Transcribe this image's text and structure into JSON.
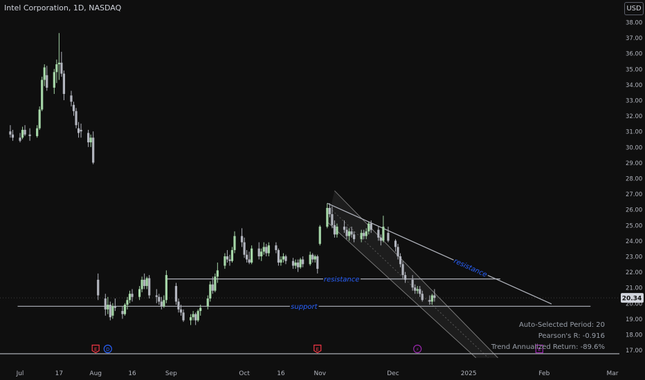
{
  "header": {
    "title": "Intel Corporation, 1D, NASDAQ",
    "currency": "USD"
  },
  "price_label": "20.34",
  "stats": {
    "period": "Auto-Selected Period: 20",
    "pearson": "Pearson's R: -0.916",
    "trend": "Trend Annualized Return: -89.6%"
  },
  "colors": {
    "up": "#a5d6a7",
    "down": "#b2b5be",
    "background": "#0f0f0f",
    "annotation": "#2962ff",
    "event": "#f23645",
    "dividend": "#2962ff",
    "split": "#9c27b0"
  },
  "chart_data": {
    "type": "candlestick",
    "title": "Intel Corporation, 1D, NASDAQ",
    "ylim": [
      16.5,
      39.0
    ],
    "y_ticks": [
      "17.00",
      "18.00",
      "19.00",
      "20.00",
      "21.00",
      "22.00",
      "23.00",
      "24.00",
      "25.00",
      "26.00",
      "27.00",
      "28.00",
      "29.00",
      "30.00",
      "31.00",
      "32.00",
      "33.00",
      "34.00",
      "35.00",
      "36.00",
      "37.00",
      "38.00"
    ],
    "x_ticks": [
      {
        "label": "Jul",
        "date": "2024-07-01"
      },
      {
        "label": "17",
        "date": "2024-07-17"
      },
      {
        "label": "Aug",
        "date": "2024-08-01"
      },
      {
        "label": "16",
        "date": "2024-08-16"
      },
      {
        "label": "Sep",
        "date": "2024-09-01"
      },
      {
        "label": "Oct",
        "date": "2024-10-01"
      },
      {
        "label": "16",
        "date": "2024-10-16"
      },
      {
        "label": "Nov",
        "date": "2024-11-01"
      },
      {
        "label": "Dec",
        "date": "2024-12-01"
      },
      {
        "label": "2025",
        "date": "2025-01-01"
      },
      {
        "label": "Feb",
        "date": "2025-02-01"
      },
      {
        "label": "Mar",
        "date": "2025-03-01"
      }
    ],
    "candles": [
      {
        "d": "2024-06-27",
        "o": 31.0,
        "h": 31.4,
        "l": 30.6,
        "c": 30.8
      },
      {
        "d": "2024-06-28",
        "o": 30.8,
        "h": 31.1,
        "l": 30.4,
        "c": 30.6
      },
      {
        "d": "2024-07-01",
        "o": 30.6,
        "h": 30.9,
        "l": 30.3,
        "c": 30.4
      },
      {
        "d": "2024-07-02",
        "o": 30.6,
        "h": 31.3,
        "l": 30.5,
        "c": 31.1
      },
      {
        "d": "2024-07-03",
        "o": 31.1,
        "h": 31.4,
        "l": 30.7,
        "c": 30.8
      },
      {
        "d": "2024-07-05",
        "o": 30.8,
        "h": 31.2,
        "l": 30.4,
        "c": 30.7
      },
      {
        "d": "2024-07-08",
        "o": 30.7,
        "h": 31.4,
        "l": 30.6,
        "c": 31.2
      },
      {
        "d": "2024-07-09",
        "o": 31.2,
        "h": 32.6,
        "l": 31.1,
        "c": 32.4
      },
      {
        "d": "2024-07-10",
        "o": 32.4,
        "h": 34.5,
        "l": 32.3,
        "c": 34.3
      },
      {
        "d": "2024-07-11",
        "o": 34.3,
        "h": 35.3,
        "l": 33.9,
        "c": 35.1
      },
      {
        "d": "2024-07-12",
        "o": 34.6,
        "h": 35.2,
        "l": 33.6,
        "c": 33.8
      },
      {
        "d": "2024-07-15",
        "o": 33.8,
        "h": 35.0,
        "l": 33.4,
        "c": 34.8
      },
      {
        "d": "2024-07-16",
        "o": 34.8,
        "h": 35.6,
        "l": 34.1,
        "c": 35.3
      },
      {
        "d": "2024-07-17",
        "o": 35.3,
        "h": 37.3,
        "l": 34.3,
        "c": 35.4
      },
      {
        "d": "2024-07-18",
        "o": 35.4,
        "h": 36.1,
        "l": 34.5,
        "c": 34.7
      },
      {
        "d": "2024-07-19",
        "o": 34.7,
        "h": 34.9,
        "l": 33.0,
        "c": 33.4
      },
      {
        "d": "2024-07-22",
        "o": 33.3,
        "h": 33.6,
        "l": 32.6,
        "c": 32.9
      },
      {
        "d": "2024-07-23",
        "o": 32.7,
        "h": 32.9,
        "l": 32.0,
        "c": 32.3
      },
      {
        "d": "2024-07-24",
        "o": 32.3,
        "h": 32.5,
        "l": 31.2,
        "c": 31.4
      },
      {
        "d": "2024-07-25",
        "o": 31.2,
        "h": 31.6,
        "l": 30.6,
        "c": 30.9
      },
      {
        "d": "2024-07-26",
        "o": 31.1,
        "h": 31.5,
        "l": 30.6,
        "c": 31.0
      },
      {
        "d": "2024-07-29",
        "o": 30.9,
        "h": 31.1,
        "l": 30.0,
        "c": 30.3
      },
      {
        "d": "2024-07-30",
        "o": 30.3,
        "h": 30.8,
        "l": 30.0,
        "c": 30.6
      },
      {
        "d": "2024-07-31",
        "o": 30.6,
        "h": 31.0,
        "l": 28.9,
        "c": 29.0
      },
      {
        "d": "2024-08-02",
        "o": 21.5,
        "h": 21.9,
        "l": 20.2,
        "c": 20.5
      },
      {
        "d": "2024-08-05",
        "o": 20.3,
        "h": 20.6,
        "l": 19.2,
        "c": 19.6
      },
      {
        "d": "2024-08-06",
        "o": 19.6,
        "h": 20.4,
        "l": 19.3,
        "c": 19.9
      },
      {
        "d": "2024-08-07",
        "o": 19.9,
        "h": 20.1,
        "l": 18.9,
        "c": 19.1
      },
      {
        "d": "2024-08-08",
        "o": 19.2,
        "h": 20.0,
        "l": 19.0,
        "c": 19.8
      },
      {
        "d": "2024-08-09",
        "o": 19.8,
        "h": 20.3,
        "l": 19.5,
        "c": 19.7
      },
      {
        "d": "2024-08-12",
        "o": 19.5,
        "h": 19.8,
        "l": 19.0,
        "c": 19.3
      },
      {
        "d": "2024-08-13",
        "o": 19.3,
        "h": 20.0,
        "l": 19.2,
        "c": 19.9
      },
      {
        "d": "2024-08-14",
        "o": 19.9,
        "h": 20.4,
        "l": 19.6,
        "c": 20.2
      },
      {
        "d": "2024-08-15",
        "o": 20.2,
        "h": 20.8,
        "l": 20.0,
        "c": 20.6
      },
      {
        "d": "2024-08-16",
        "o": 20.6,
        "h": 20.9,
        "l": 20.1,
        "c": 20.4
      },
      {
        "d": "2024-08-19",
        "o": 20.4,
        "h": 21.1,
        "l": 20.2,
        "c": 20.9
      },
      {
        "d": "2024-08-20",
        "o": 20.9,
        "h": 21.7,
        "l": 20.7,
        "c": 21.5
      },
      {
        "d": "2024-08-21",
        "o": 21.5,
        "h": 21.9,
        "l": 20.9,
        "c": 21.1
      },
      {
        "d": "2024-08-22",
        "o": 21.1,
        "h": 21.7,
        "l": 20.9,
        "c": 21.6
      },
      {
        "d": "2024-08-23",
        "o": 21.6,
        "h": 21.8,
        "l": 20.3,
        "c": 20.5
      },
      {
        "d": "2024-08-26",
        "o": 20.5,
        "h": 20.9,
        "l": 20.0,
        "c": 20.4
      },
      {
        "d": "2024-08-27",
        "o": 20.4,
        "h": 20.6,
        "l": 19.9,
        "c": 20.1
      },
      {
        "d": "2024-08-28",
        "o": 20.1,
        "h": 20.4,
        "l": 19.6,
        "c": 19.8
      },
      {
        "d": "2024-08-29",
        "o": 19.8,
        "h": 20.5,
        "l": 19.7,
        "c": 20.2
      },
      {
        "d": "2024-08-30",
        "o": 20.2,
        "h": 22.1,
        "l": 20.0,
        "c": 21.8
      },
      {
        "d": "2024-09-03",
        "o": 21.1,
        "h": 21.3,
        "l": 19.9,
        "c": 20.1
      },
      {
        "d": "2024-09-04",
        "o": 20.1,
        "h": 20.3,
        "l": 19.4,
        "c": 19.6
      },
      {
        "d": "2024-09-05",
        "o": 19.6,
        "h": 19.9,
        "l": 19.2,
        "c": 19.4
      },
      {
        "d": "2024-09-06",
        "o": 19.4,
        "h": 19.6,
        "l": 18.8,
        "c": 18.9
      },
      {
        "d": "2024-09-09",
        "o": 18.9,
        "h": 19.3,
        "l": 18.6,
        "c": 19.1
      },
      {
        "d": "2024-09-10",
        "o": 19.1,
        "h": 19.5,
        "l": 18.9,
        "c": 19.3
      },
      {
        "d": "2024-09-11",
        "o": 19.3,
        "h": 19.4,
        "l": 18.6,
        "c": 18.9
      },
      {
        "d": "2024-09-12",
        "o": 18.9,
        "h": 19.6,
        "l": 18.8,
        "c": 19.5
      },
      {
        "d": "2024-09-13",
        "o": 19.5,
        "h": 19.9,
        "l": 19.2,
        "c": 19.7
      },
      {
        "d": "2024-09-16",
        "o": 19.8,
        "h": 20.5,
        "l": 19.6,
        "c": 20.3
      },
      {
        "d": "2024-09-17",
        "o": 20.3,
        "h": 21.4,
        "l": 20.1,
        "c": 21.2
      },
      {
        "d": "2024-09-18",
        "o": 21.2,
        "h": 21.7,
        "l": 20.6,
        "c": 20.8
      },
      {
        "d": "2024-09-19",
        "o": 20.8,
        "h": 21.9,
        "l": 20.7,
        "c": 21.7
      },
      {
        "d": "2024-09-20",
        "o": 21.7,
        "h": 22.6,
        "l": 21.3,
        "c": 22.1
      },
      {
        "d": "2024-09-23",
        "o": 22.4,
        "h": 23.2,
        "l": 22.2,
        "c": 23.0
      },
      {
        "d": "2024-09-24",
        "o": 23.0,
        "h": 23.4,
        "l": 22.6,
        "c": 22.8
      },
      {
        "d": "2024-09-25",
        "o": 22.8,
        "h": 23.1,
        "l": 22.4,
        "c": 22.7
      },
      {
        "d": "2024-09-26",
        "o": 22.7,
        "h": 23.6,
        "l": 22.6,
        "c": 23.4
      },
      {
        "d": "2024-09-27",
        "o": 23.4,
        "h": 24.6,
        "l": 23.2,
        "c": 24.3
      },
      {
        "d": "2024-09-30",
        "o": 24.3,
        "h": 24.8,
        "l": 23.6,
        "c": 23.9
      },
      {
        "d": "2024-10-01",
        "o": 23.9,
        "h": 24.2,
        "l": 22.9,
        "c": 23.1
      },
      {
        "d": "2024-10-02",
        "o": 23.1,
        "h": 23.4,
        "l": 22.6,
        "c": 22.8
      },
      {
        "d": "2024-10-03",
        "o": 22.8,
        "h": 23.3,
        "l": 22.5,
        "c": 22.6
      },
      {
        "d": "2024-10-04",
        "o": 22.6,
        "h": 23.7,
        "l": 22.5,
        "c": 23.5
      },
      {
        "d": "2024-10-07",
        "o": 23.5,
        "h": 23.9,
        "l": 22.8,
        "c": 23.0
      },
      {
        "d": "2024-10-08",
        "o": 23.0,
        "h": 23.5,
        "l": 22.7,
        "c": 23.3
      },
      {
        "d": "2024-10-09",
        "o": 23.3,
        "h": 23.9,
        "l": 23.1,
        "c": 23.6
      },
      {
        "d": "2024-10-10",
        "o": 23.6,
        "h": 23.8,
        "l": 23.0,
        "c": 23.2
      },
      {
        "d": "2024-10-11",
        "o": 23.2,
        "h": 23.9,
        "l": 23.0,
        "c": 23.7
      },
      {
        "d": "2024-10-14",
        "o": 23.7,
        "h": 23.9,
        "l": 23.2,
        "c": 23.4
      },
      {
        "d": "2024-10-15",
        "o": 23.4,
        "h": 23.5,
        "l": 22.4,
        "c": 22.6
      },
      {
        "d": "2024-10-16",
        "o": 22.6,
        "h": 23.0,
        "l": 22.4,
        "c": 22.8
      },
      {
        "d": "2024-10-17",
        "o": 22.8,
        "h": 23.2,
        "l": 22.6,
        "c": 23.0
      },
      {
        "d": "2024-10-18",
        "o": 23.0,
        "h": 23.1,
        "l": 22.5,
        "c": 22.7
      },
      {
        "d": "2024-10-21",
        "o": 22.7,
        "h": 22.9,
        "l": 22.2,
        "c": 22.4
      },
      {
        "d": "2024-10-22",
        "o": 22.4,
        "h": 22.8,
        "l": 22.2,
        "c": 22.6
      },
      {
        "d": "2024-10-23",
        "o": 22.6,
        "h": 22.8,
        "l": 22.0,
        "c": 22.3
      },
      {
        "d": "2024-10-24",
        "o": 22.3,
        "h": 22.9,
        "l": 22.2,
        "c": 22.8
      },
      {
        "d": "2024-10-25",
        "o": 22.8,
        "h": 23.0,
        "l": 22.3,
        "c": 22.5
      },
      {
        "d": "2024-10-28",
        "o": 22.5,
        "h": 23.3,
        "l": 22.4,
        "c": 23.1
      },
      {
        "d": "2024-10-29",
        "o": 23.1,
        "h": 23.2,
        "l": 22.6,
        "c": 22.8
      },
      {
        "d": "2024-10-30",
        "o": 22.8,
        "h": 23.1,
        "l": 22.6,
        "c": 23.0
      },
      {
        "d": "2024-10-31",
        "o": 23.0,
        "h": 23.1,
        "l": 21.9,
        "c": 22.2
      },
      {
        "d": "2024-11-01",
        "o": 23.8,
        "h": 25.0,
        "l": 23.7,
        "c": 24.9
      },
      {
        "d": "2024-11-04",
        "o": 24.9,
        "h": 26.4,
        "l": 24.8,
        "c": 26.1
      },
      {
        "d": "2024-11-05",
        "o": 26.1,
        "h": 26.4,
        "l": 25.5,
        "c": 25.7
      },
      {
        "d": "2024-11-06",
        "o": 25.7,
        "h": 26.2,
        "l": 24.8,
        "c": 25.0
      },
      {
        "d": "2024-11-07",
        "o": 25.0,
        "h": 25.3,
        "l": 24.2,
        "c": 24.4
      },
      {
        "d": "2024-11-08",
        "o": 24.4,
        "h": 25.1,
        "l": 24.2,
        "c": 24.9
      },
      {
        "d": "2024-11-11",
        "o": 24.9,
        "h": 25.3,
        "l": 24.5,
        "c": 24.7
      },
      {
        "d": "2024-11-12",
        "o": 24.7,
        "h": 24.9,
        "l": 24.1,
        "c": 24.3
      },
      {
        "d": "2024-11-13",
        "o": 24.3,
        "h": 24.8,
        "l": 24.0,
        "c": 24.6
      },
      {
        "d": "2024-11-14",
        "o": 24.6,
        "h": 24.9,
        "l": 24.2,
        "c": 24.4
      },
      {
        "d": "2024-11-15",
        "o": 24.4,
        "h": 24.6,
        "l": 23.9,
        "c": 24.1
      },
      {
        "d": "2024-11-18",
        "o": 24.1,
        "h": 24.7,
        "l": 23.9,
        "c": 24.5
      },
      {
        "d": "2024-11-19",
        "o": 24.5,
        "h": 24.7,
        "l": 24.1,
        "c": 24.3
      },
      {
        "d": "2024-11-20",
        "o": 24.3,
        "h": 24.8,
        "l": 24.1,
        "c": 24.6
      },
      {
        "d": "2024-11-21",
        "o": 24.6,
        "h": 25.2,
        "l": 24.4,
        "c": 25.1
      },
      {
        "d": "2024-11-22",
        "o": 25.1,
        "h": 25.3,
        "l": 24.5,
        "c": 24.7
      },
      {
        "d": "2024-11-25",
        "o": 24.7,
        "h": 24.9,
        "l": 24.0,
        "c": 24.2
      },
      {
        "d": "2024-11-26",
        "o": 24.2,
        "h": 24.4,
        "l": 23.7,
        "c": 24.0
      },
      {
        "d": "2024-11-27",
        "o": 24.0,
        "h": 25.6,
        "l": 23.9,
        "c": 24.9
      },
      {
        "d": "2024-11-29",
        "o": 24.5,
        "h": 24.9,
        "l": 23.9,
        "c": 24.0
      },
      {
        "d": "2024-12-02",
        "o": 24.0,
        "h": 24.1,
        "l": 23.3,
        "c": 23.6
      },
      {
        "d": "2024-12-03",
        "o": 23.6,
        "h": 23.8,
        "l": 22.8,
        "c": 23.0
      },
      {
        "d": "2024-12-04",
        "o": 23.0,
        "h": 23.2,
        "l": 22.3,
        "c": 22.5
      },
      {
        "d": "2024-12-05",
        "o": 22.5,
        "h": 22.7,
        "l": 21.6,
        "c": 21.8
      },
      {
        "d": "2024-12-06",
        "o": 21.8,
        "h": 22.0,
        "l": 21.3,
        "c": 21.5
      },
      {
        "d": "2024-12-09",
        "o": 21.5,
        "h": 21.8,
        "l": 20.8,
        "c": 21.0
      },
      {
        "d": "2024-12-10",
        "o": 21.0,
        "h": 21.2,
        "l": 20.6,
        "c": 20.8
      },
      {
        "d": "2024-12-11",
        "o": 20.8,
        "h": 21.1,
        "l": 20.6,
        "c": 20.9
      },
      {
        "d": "2024-12-12",
        "o": 20.9,
        "h": 21.1,
        "l": 20.4,
        "c": 20.6
      },
      {
        "d": "2024-12-13",
        "o": 20.6,
        "h": 20.8,
        "l": 20.1,
        "c": 20.2
      },
      {
        "d": "2024-12-16",
        "o": 20.2,
        "h": 20.5,
        "l": 19.9,
        "c": 20.1
      },
      {
        "d": "2024-12-17",
        "o": 20.1,
        "h": 20.6,
        "l": 19.9,
        "c": 20.5
      },
      {
        "d": "2024-12-18",
        "o": 20.5,
        "h": 20.9,
        "l": 20.1,
        "c": 20.34
      }
    ],
    "annotations": [
      {
        "label": "resistance",
        "from": {
          "d": "2024-08-30",
          "y": 21.55
        },
        "to": {
          "d": "2025-01-14",
          "y": 21.55
        }
      },
      {
        "label": "support",
        "from": {
          "d": "2024-06-30",
          "y": 19.8
        },
        "to": {
          "d": "2025-02-20",
          "y": 19.8
        }
      },
      {
        "label": "resistance",
        "from": {
          "d": "2024-11-04",
          "y": 26.4
        },
        "to": {
          "d": "2025-02-04",
          "y": 19.95
        }
      }
    ],
    "trend_channel": {
      "upper": {
        "from": {
          "d": "2024-11-07",
          "y": 27.2
        },
        "to": {
          "d": "2025-01-13",
          "y": 16.5
        }
      },
      "lower": {
        "from": {
          "d": "2024-11-04",
          "y": 25.2
        },
        "to": {
          "d": "2025-01-04",
          "y": 16.5
        }
      },
      "middle": {
        "from": {
          "d": "2024-11-05",
          "y": 26.1
        },
        "to": {
          "d": "2025-01-09",
          "y": 16.5
        }
      }
    },
    "events": [
      {
        "d": "2024-08-01",
        "type": "earnings",
        "label": "E"
      },
      {
        "d": "2024-08-06",
        "type": "dividend",
        "label": "D"
      },
      {
        "d": "2024-10-31",
        "type": "earnings",
        "label": "E"
      },
      {
        "d": "2024-12-11",
        "type": "split",
        "label": "⚡"
      },
      {
        "d": "2025-01-30",
        "type": "earnings-future",
        "label": "E"
      }
    ]
  }
}
